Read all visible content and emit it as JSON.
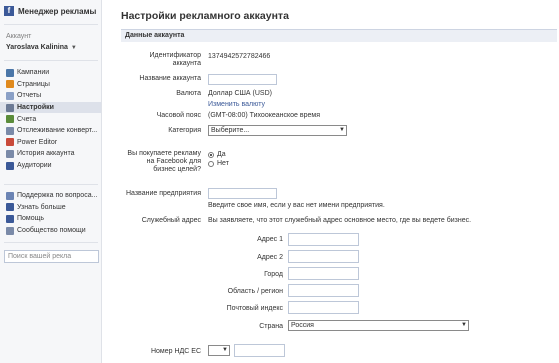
{
  "sidebar": {
    "title": "Менеджер рекламы",
    "account_heading": "Аккаунт",
    "account_name": "Yaroslava Kalinina",
    "nav": [
      {
        "label": "Кампании",
        "icon": "campaigns-icon",
        "color": "#4a76a8"
      },
      {
        "label": "Страницы",
        "icon": "pages-icon",
        "color": "#e08a1e"
      },
      {
        "label": "Отчеты",
        "icon": "reports-icon",
        "color": "#8aa0c6"
      },
      {
        "label": "Настройки",
        "icon": "settings-icon",
        "color": "#6c7a95",
        "active": true
      },
      {
        "label": "Счета",
        "icon": "billing-icon",
        "color": "#5b8c3a"
      },
      {
        "label": "Отслеживание конверт...",
        "icon": "conversion-tracking-icon",
        "color": "#7a8aa8"
      },
      {
        "label": "Power Editor",
        "icon": "power-editor-icon",
        "color": "#c94a3a"
      },
      {
        "label": "История аккаунта",
        "icon": "account-history-icon",
        "color": "#7a8aa8"
      },
      {
        "label": "Аудитории",
        "icon": "audiences-icon",
        "color": "#3b5998"
      }
    ],
    "help": [
      {
        "label": "Поддержка по вопроса...",
        "icon": "support-icon",
        "color": "#6b84b4"
      },
      {
        "label": "Узнать больше",
        "icon": "learn-more-icon",
        "color": "#3b5998"
      },
      {
        "label": "Помощь",
        "icon": "help-icon",
        "color": "#3b5998"
      },
      {
        "label": "Сообщество помощи",
        "icon": "community-icon",
        "color": "#7a8aa8"
      }
    ],
    "search_placeholder": "Поиск вашей рекла"
  },
  "page": {
    "title": "Настройки рекламного аккаунта",
    "section": "Данные аккаунта",
    "fields": {
      "id_label": "Идентификатор аккаунта",
      "id_value": "1374942572782466",
      "name_label": "Название аккаунта",
      "currency_label": "Валюта",
      "currency_value": "Доллар США (USD)",
      "currency_link": "Изменить валюту",
      "tz_label": "Часовой пояс",
      "tz_value": "(GMT-08:00) Тихоокеанское время",
      "category_label": "Категория",
      "category_value": "Выберите...",
      "business_label": "Вы покупаете рекламу на Facebook для бизнес целей?",
      "yes": "Да",
      "no": "Нет",
      "company_label": "Название предприятия",
      "company_help": "Введите свое имя, если у вас нет имени предприятия.",
      "address_label": "Служебный адрес",
      "address_help": "Вы заявляете, что этот служебный адрес основное место, где вы ведете бизнес.",
      "addr1": "Адрес 1",
      "addr2": "Адрес 2",
      "city": "Город",
      "region": "Область / регион",
      "postal": "Почтовый индекс",
      "country": "Страна",
      "country_value": "Россия",
      "vat": "Номер НДС ЕС"
    }
  }
}
